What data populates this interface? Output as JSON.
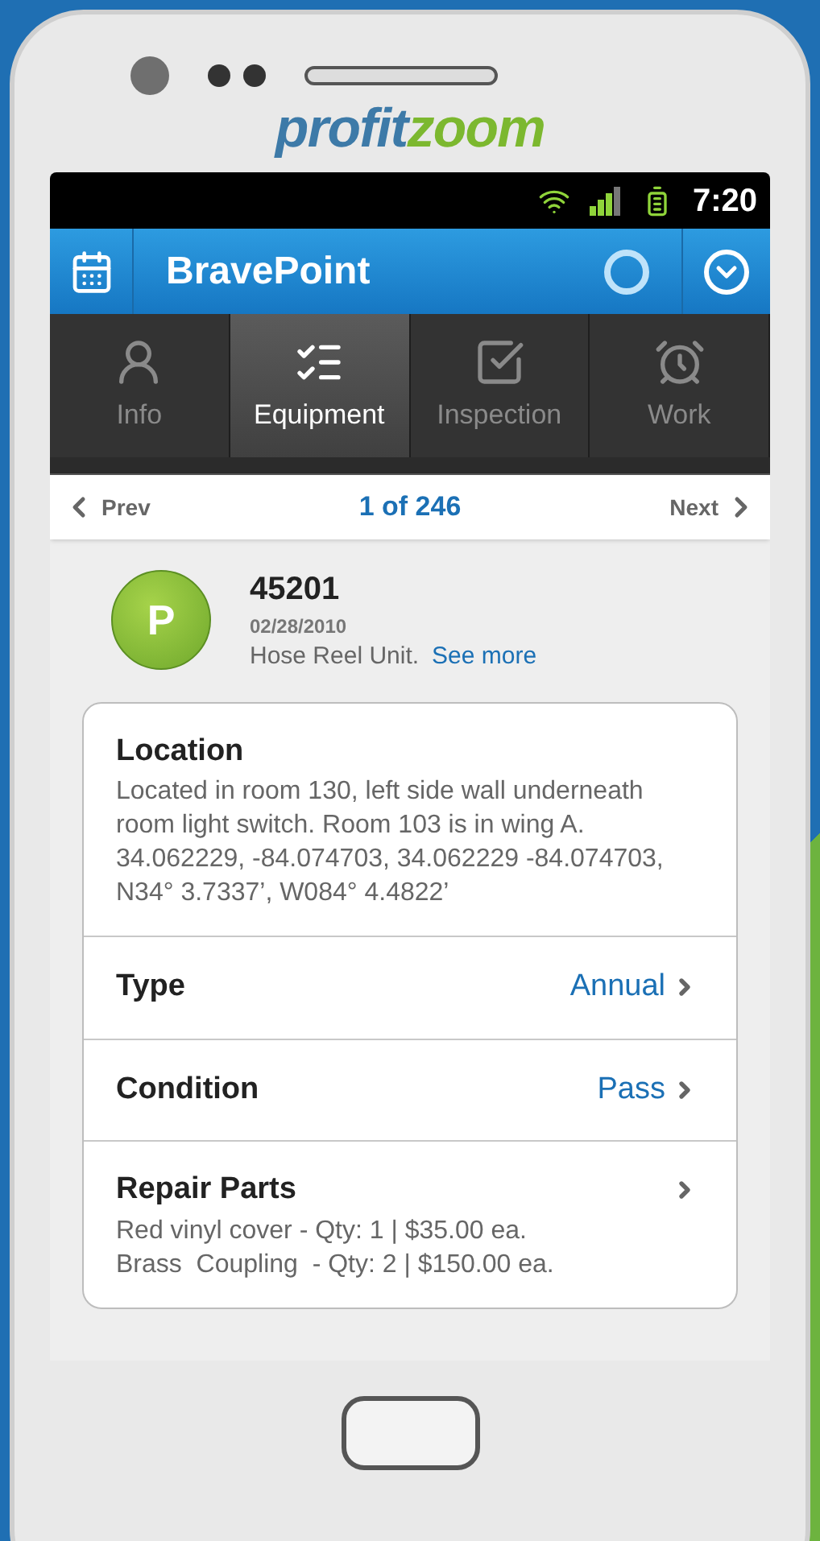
{
  "logo": {
    "part_1": "profit",
    "part_2": "zoom"
  },
  "status_bar": {
    "time": "7:20"
  },
  "app_bar": {
    "title": "BravePoint"
  },
  "tabs": [
    {
      "label": "Info",
      "selected": false
    },
    {
      "label": "Equipment",
      "selected": true
    },
    {
      "label": "Inspection",
      "selected": false
    },
    {
      "label": "Work",
      "selected": false
    }
  ],
  "pager": {
    "prev": "Prev",
    "position": "1 of 246",
    "next": "Next"
  },
  "equipment": {
    "badge": "P",
    "number": "45201",
    "date": "02/28/2010",
    "description": "Hose Reel Unit.",
    "link": "See more"
  },
  "details": [
    {
      "kind": "note",
      "label": "Location",
      "lines": [
        "Located in room 130, left side wall underneath room light switch. Room 103 is in wing A. 34.062229, -84.074703, 34.062229 -84.074703, N34° 3.7337’, W084° 4.4822’"
      ]
    },
    {
      "kind": "value",
      "label": "Type",
      "value": "Annual"
    },
    {
      "kind": "value",
      "label": "Condition",
      "value": "Pass"
    },
    {
      "kind": "list",
      "label": "Repair Parts",
      "lines": [
        "Red vinyl cover - Qty: 1 | $35.00 ea.",
        "Brass  Coupling  - Qty: 2 | $150.00 ea."
      ]
    }
  ]
}
